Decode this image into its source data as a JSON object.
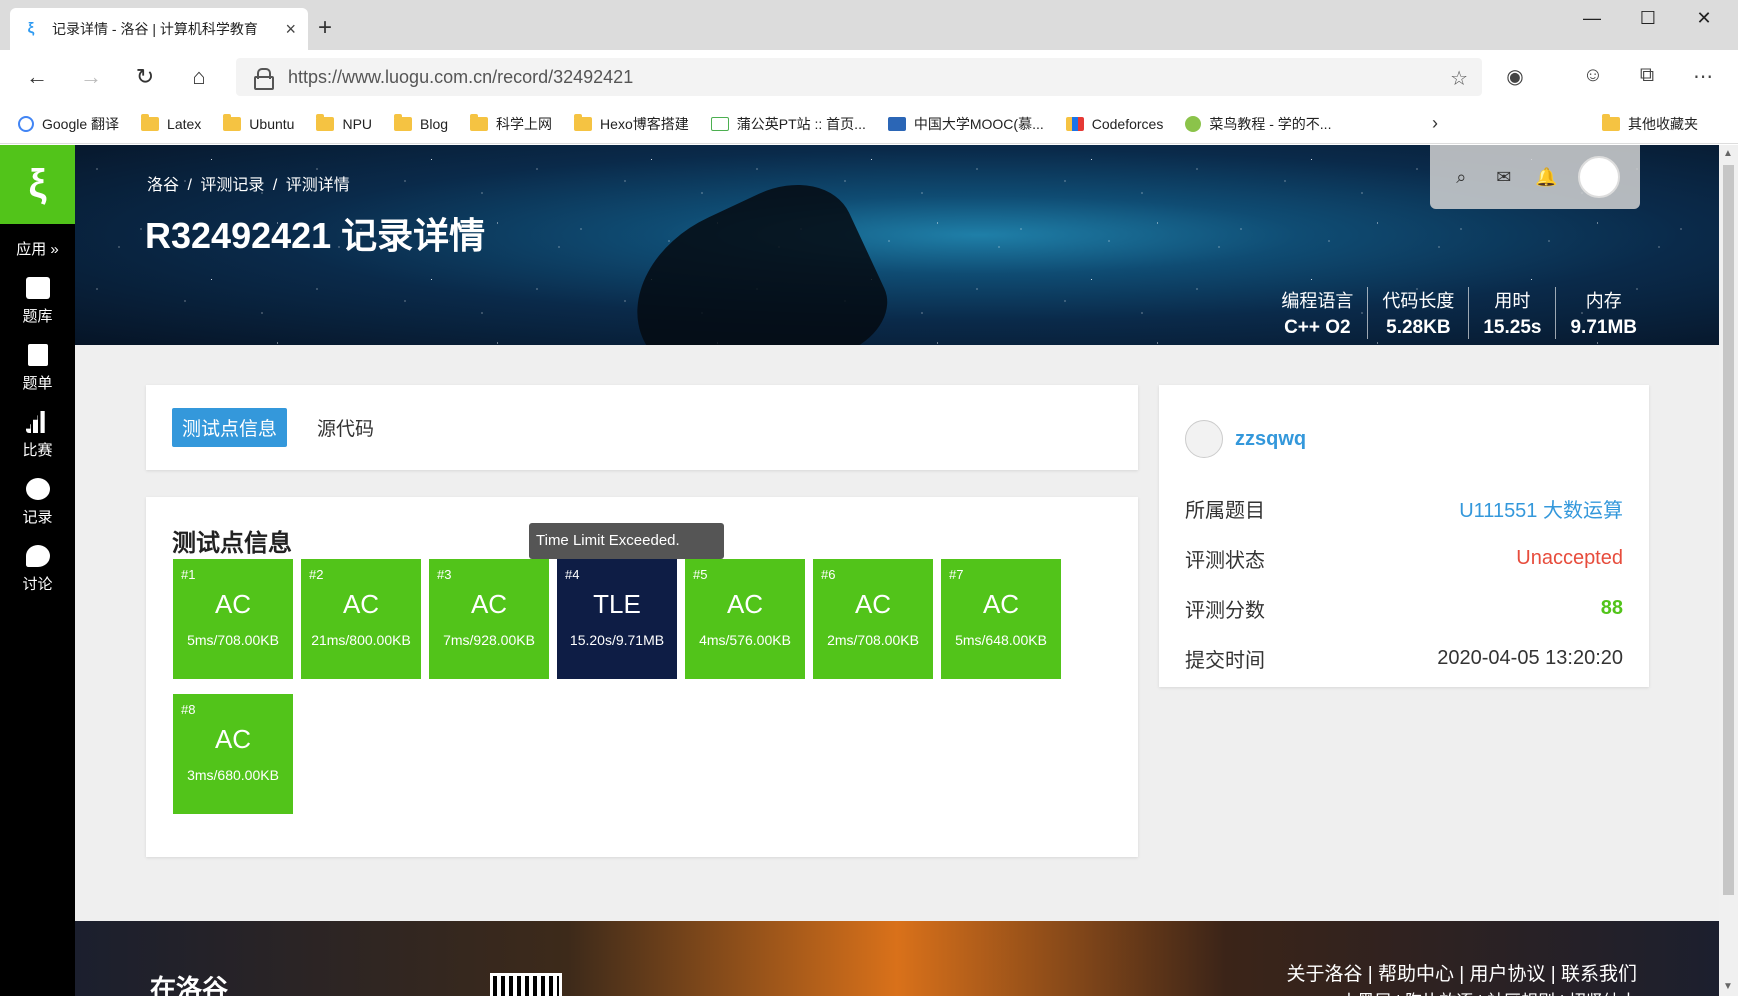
{
  "browser": {
    "tab_title": "记录详情 - 洛谷 | 计算机科学教育",
    "url": "https://www.luogu.com.cn/record/32492421",
    "bookmarks": [
      {
        "label": "Google 翻译",
        "icon": "google-icon"
      },
      {
        "label": "Latex",
        "icon": "folder-icon"
      },
      {
        "label": "Ubuntu",
        "icon": "folder-icon"
      },
      {
        "label": "NPU",
        "icon": "folder-icon"
      },
      {
        "label": "Blog",
        "icon": "folder-icon"
      },
      {
        "label": "科学上网",
        "icon": "folder-icon"
      },
      {
        "label": "Hexo博客搭建",
        "icon": "folder-icon"
      },
      {
        "label": "蒲公英PT站 :: 首页...",
        "icon": "page-icon"
      },
      {
        "label": "中国大学MOOC(慕...",
        "icon": "mooc-icon"
      },
      {
        "label": "Codeforces",
        "icon": "codeforces-icon"
      },
      {
        "label": "菜鸟教程 - 学的不...",
        "icon": "runoob-icon"
      }
    ],
    "other_bookmarks": "其他收藏夹"
  },
  "sidebar": {
    "apps_label": "应用 »",
    "items": [
      {
        "label": "题库",
        "icon": "book-icon"
      },
      {
        "label": "题单",
        "icon": "clipboard-icon"
      },
      {
        "label": "比赛",
        "icon": "bar-chart-icon"
      },
      {
        "label": "记录",
        "icon": "pie-chart-icon"
      },
      {
        "label": "讨论",
        "icon": "chat-icon"
      }
    ]
  },
  "banner": {
    "breadcrumbs": [
      "洛谷",
      "/",
      "评测记录",
      "/",
      "评测详情"
    ],
    "title": "R32492421 记录详情",
    "stats": [
      {
        "label": "编程语言",
        "value": "C++ O2"
      },
      {
        "label": "代码长度",
        "value": "5.28KB"
      },
      {
        "label": "用时",
        "value": "15.25s"
      },
      {
        "label": "内存",
        "value": "9.71MB"
      }
    ]
  },
  "tabs": {
    "active": "测试点信息",
    "other": "源代码"
  },
  "cases": {
    "title": "测试点信息",
    "tooltip": "Time Limit Exceeded.",
    "items": [
      {
        "id": "#1",
        "status": "AC",
        "detail": "5ms/708.00KB"
      },
      {
        "id": "#2",
        "status": "AC",
        "detail": "21ms/800.00KB"
      },
      {
        "id": "#3",
        "status": "AC",
        "detail": "7ms/928.00KB"
      },
      {
        "id": "#4",
        "status": "TLE",
        "detail": "15.20s/9.71MB"
      },
      {
        "id": "#5",
        "status": "AC",
        "detail": "4ms/576.00KB"
      },
      {
        "id": "#6",
        "status": "AC",
        "detail": "2ms/708.00KB"
      },
      {
        "id": "#7",
        "status": "AC",
        "detail": "5ms/648.00KB"
      },
      {
        "id": "#8",
        "status": "AC",
        "detail": "3ms/680.00KB"
      }
    ]
  },
  "info": {
    "username": "zzsqwq",
    "rows": [
      {
        "label": "所属题目",
        "value": "U111551 大数运算"
      },
      {
        "label": "评测状态",
        "value": "Unaccepted"
      },
      {
        "label": "评测分数",
        "value": "88"
      },
      {
        "label": "提交时间",
        "value": "2020-04-05 13:20:20"
      }
    ]
  },
  "footer": {
    "brand": "在洛谷",
    "links": "关于洛谷 | 帮助中心 | 用户协议 | 联系我们",
    "links2": "小黑屋 | 陶片放逐 | 社区规则 | 招贤纳士"
  },
  "colors": {
    "ac": "#52c41a",
    "tle": "#0e1d45",
    "link": "#3498db",
    "unaccepted": "#e74c3c"
  }
}
